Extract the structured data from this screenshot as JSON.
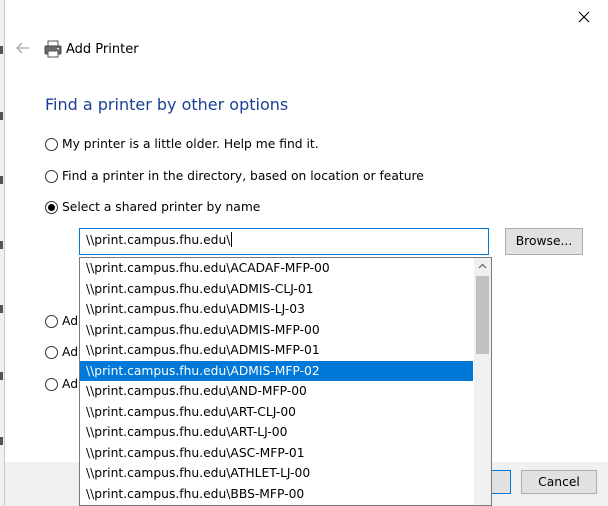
{
  "dialog": {
    "title": "Add Printer",
    "heading": "Find a printer by other options"
  },
  "options": [
    {
      "label": "My printer is a little older. Help me find it.",
      "checked": false
    },
    {
      "label": "Find a printer in the directory, based on location or feature",
      "checked": false
    },
    {
      "label": "Select a shared printer by name",
      "checked": true
    },
    {
      "label": "Ad",
      "checked": false
    },
    {
      "label": "Ad",
      "checked": false
    },
    {
      "label": "Ad",
      "checked": false
    }
  ],
  "shared_printer": {
    "input_value": "\\\\print.campus.fhu.edu\\",
    "browse_label": "Browse..."
  },
  "dropdown": {
    "selected_index": 5,
    "items": [
      "\\\\print.campus.fhu.edu\\ACADAF-MFP-00",
      "\\\\print.campus.fhu.edu\\ADMIS-CLJ-01",
      "\\\\print.campus.fhu.edu\\ADMIS-LJ-03",
      "\\\\print.campus.fhu.edu\\ADMIS-MFP-00",
      "\\\\print.campus.fhu.edu\\ADMIS-MFP-01",
      "\\\\print.campus.fhu.edu\\ADMIS-MFP-02",
      "\\\\print.campus.fhu.edu\\AND-MFP-00",
      "\\\\print.campus.fhu.edu\\ART-CLJ-00",
      "\\\\print.campus.fhu.edu\\ART-LJ-00",
      "\\\\print.campus.fhu.edu\\ASC-MFP-01",
      "\\\\print.campus.fhu.edu\\ATHLET-LJ-00",
      "\\\\print.campus.fhu.edu\\BBS-MFP-00"
    ]
  },
  "footer": {
    "cancel_label": "Cancel"
  },
  "icons": {
    "close": "close-icon",
    "back": "back-arrow-icon",
    "printer": "printer-icon",
    "scroll_up": "chevron-up-icon"
  },
  "colors": {
    "accent": "#0078d7",
    "heading": "#1c3f95",
    "selection": "#0078d7"
  }
}
